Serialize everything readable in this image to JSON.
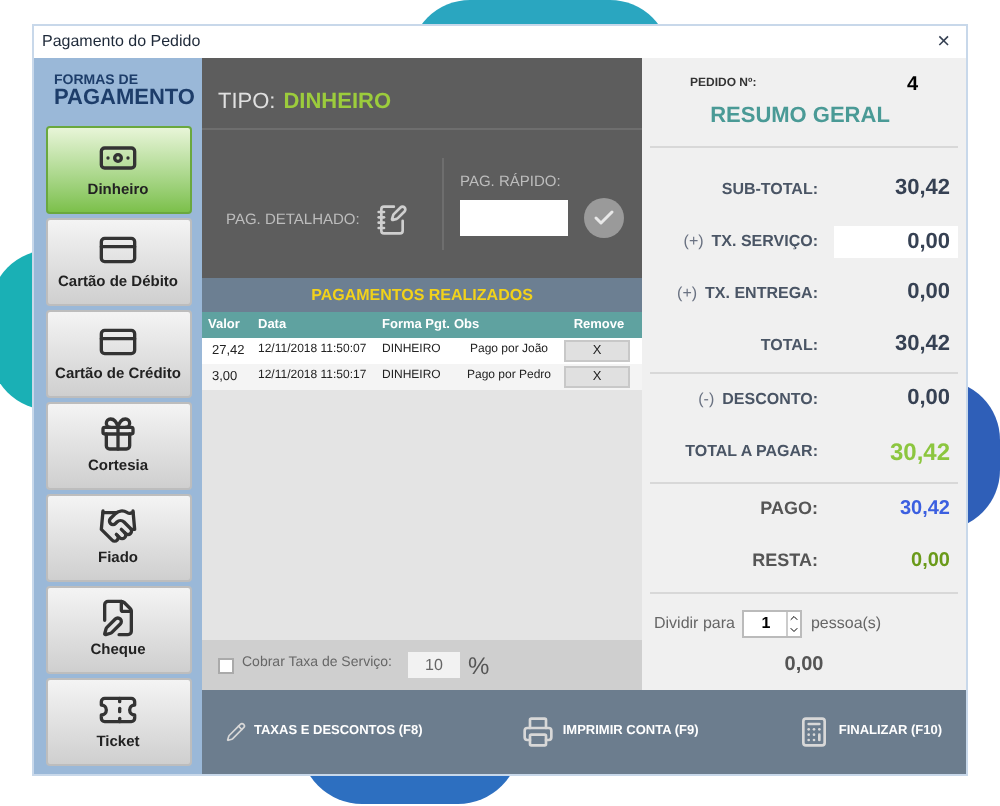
{
  "window": {
    "title": "Pagamento do Pedido",
    "close": "×"
  },
  "sidebar": {
    "heading_top": "FORMAS DE",
    "heading_bottom": "PAGAMENTO",
    "items": [
      {
        "label": "Dinheiro",
        "selected": true
      },
      {
        "label": "Cartão de Débito",
        "selected": false
      },
      {
        "label": "Cartão de Crédito",
        "selected": false
      },
      {
        "label": "Cortesia",
        "selected": false
      },
      {
        "label": "Fiado",
        "selected": false
      },
      {
        "label": "Cheque",
        "selected": false
      },
      {
        "label": "Ticket",
        "selected": false
      }
    ]
  },
  "tipo": {
    "label": "TIPO:",
    "value": "DINHEIRO"
  },
  "pag_detalhado": {
    "label": "PAG. DETALHADO:"
  },
  "pag_rapido": {
    "label": "PAG. RÁPIDO:"
  },
  "payments": {
    "title": "PAGAMENTOS REALIZADOS",
    "columns": [
      "Valor",
      "Data",
      "Forma Pgt.",
      "Obs",
      "Remove"
    ],
    "rows": [
      {
        "valor": "27,42",
        "data": "12/11/2018 11:50:07",
        "forma": "DINHEIRO",
        "obs": "Pago por João",
        "remove": "X"
      },
      {
        "valor": "3,00",
        "data": "12/11/2018 11:50:17",
        "forma": "DINHEIRO",
        "obs": "Pago por Pedro",
        "remove": "X"
      }
    ]
  },
  "service_fee": {
    "label": "Cobrar Taxa de Serviço:",
    "checked": false,
    "value": "10",
    "unit": "%"
  },
  "summary": {
    "order_label": "PEDIDO Nº:",
    "order_number": "4",
    "title": "RESUMO GERAL",
    "subtotal_label": "SUB-TOTAL:",
    "subtotal": "30,42",
    "service_sign": "(+)",
    "service_label": "TX. SERVIÇO:",
    "service": "0,00",
    "delivery_sign": "(+)",
    "delivery_label": "TX. ENTREGA:",
    "delivery": "0,00",
    "total_label": "TOTAL:",
    "total": "30,42",
    "discount_sign": "(-)",
    "discount_label": "DESCONTO:",
    "discount": "0,00",
    "to_pay_label": "TOTAL A PAGAR:",
    "to_pay": "30,42",
    "paid_label": "PAGO:",
    "paid": "30,42",
    "rest_label": "RESTA:",
    "rest": "0,00",
    "split_label": "Dividir para",
    "split_value": "1",
    "split_unit": "pessoa(s)",
    "split_result": "0,00"
  },
  "actions": [
    "TAXAS E DESCONTOS (F8)",
    "IMPRIMIR CONTA (F9)",
    "FINALIZAR (F10)"
  ]
}
